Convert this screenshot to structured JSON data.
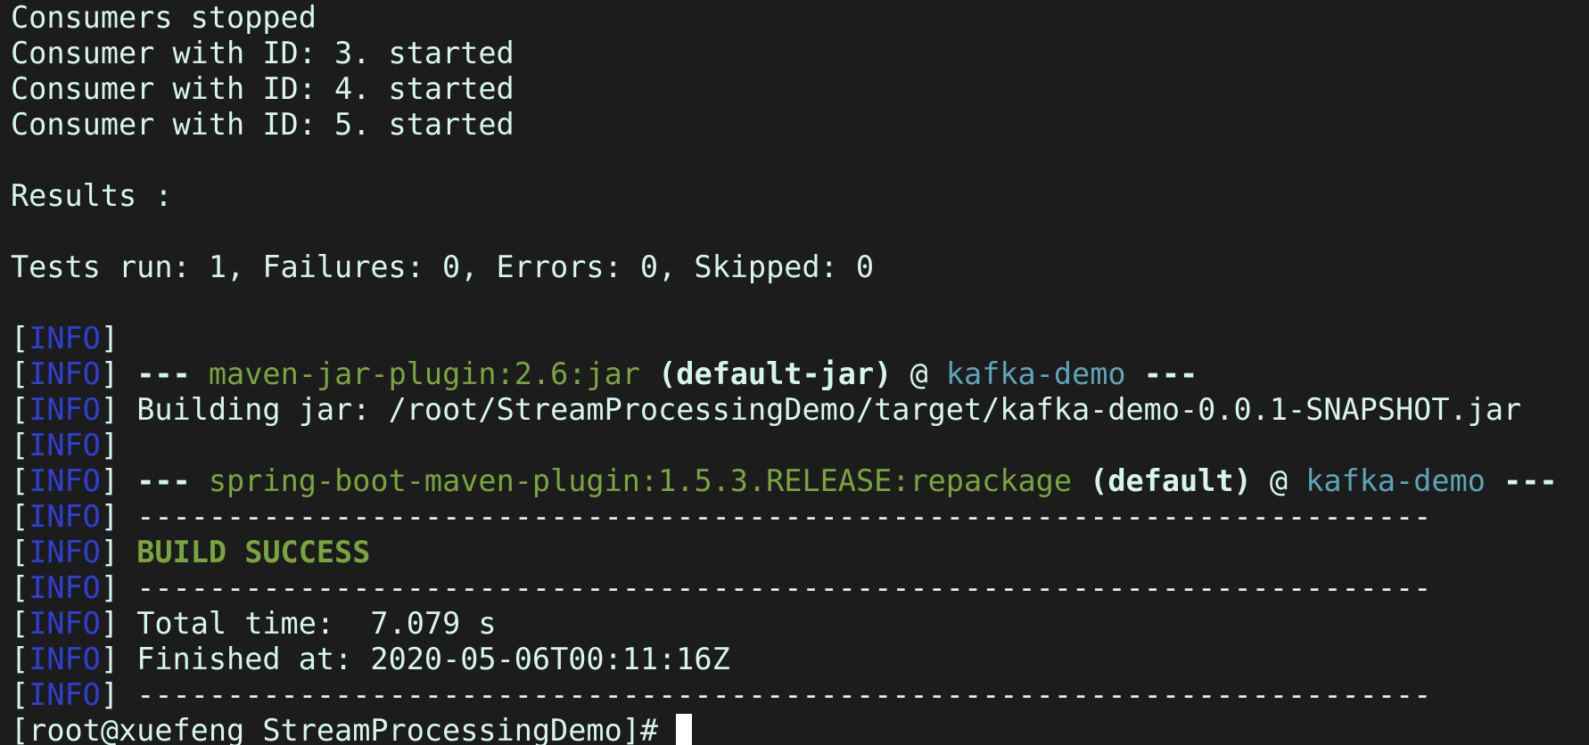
{
  "terminal": {
    "lines_top": [
      "Consumers stopped",
      "Consumer with ID: 3. started",
      "Consumer with ID: 4. started",
      "Consumer with ID: 5. started",
      "",
      "Results :",
      "",
      "Tests run: 1, Failures: 0, Errors: 0, Skipped: 0",
      ""
    ],
    "info_tag": "INFO",
    "jar_plugin": {
      "dashes_open": "---",
      "plugin": "maven-jar-plugin:2.6:jar",
      "execution": "(default-jar)",
      "at": "@",
      "project": "kafka-demo",
      "dashes_close": "---"
    },
    "building_jar": "Building jar: /root/StreamProcessingDemo/target/kafka-demo-0.0.1-SNAPSHOT.jar",
    "boot_plugin": {
      "dashes_open": "---",
      "plugin": "spring-boot-maven-plugin:1.5.3.RELEASE:repackage",
      "execution": "(default)",
      "at": "@",
      "project": "kafka-demo",
      "dashes_close": "---"
    },
    "separator": "------------------------------------------------------------------------",
    "build_status": "BUILD SUCCESS",
    "total_time": "Total time:  7.079 s",
    "finished_at": "Finished at: 2020-05-06T00:11:16Z",
    "prompt": "[root@xuefeng StreamProcessingDemo]# "
  },
  "colors": {
    "background": "#1c1c1c",
    "text": "#d6f5ef",
    "info": "#2f3fd3",
    "plugin_green": "#7aa43f",
    "project_teal": "#5da4b8"
  }
}
